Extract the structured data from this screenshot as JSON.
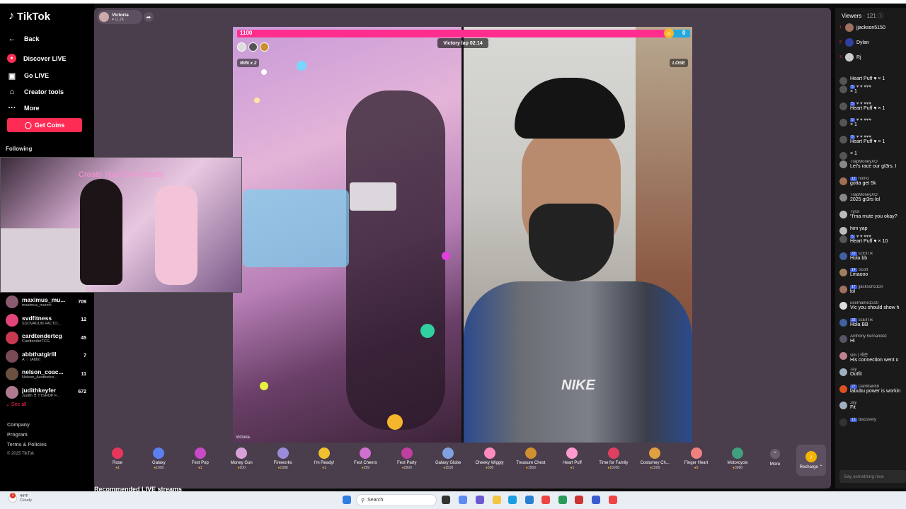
{
  "app": {
    "logo": "TikTok"
  },
  "sidebar": {
    "back": "Back",
    "nav": [
      {
        "label": "Discover LIVE",
        "icon": "live-icon"
      },
      {
        "label": "Go LIVE",
        "icon": "camera-icon"
      },
      {
        "label": "Creator tools",
        "icon": "home-icon"
      },
      {
        "label": "More",
        "icon": "more-icon"
      }
    ],
    "get_coins": "Get Coins",
    "following_title": "Following",
    "following": [
      {
        "name": "maximus_mu...",
        "sub": "maximus_munch",
        "count": "709",
        "color": "#8a5a70"
      },
      {
        "name": "svdfitness",
        "sub": "SUOVADUN FACTO...",
        "count": "12",
        "color": "#e0457b"
      },
      {
        "name": "cardtendertcg",
        "sub": "CardtenderTCG",
        "count": "45",
        "color": "#c8394f"
      },
      {
        "name": "abbthatgirlll",
        "sub": "A ♡ (Abbi)",
        "count": "7",
        "color": "#7a4a55"
      },
      {
        "name": "nelson_coac...",
        "sub": "Nelson_Aesthetics...",
        "count": "11",
        "color": "#6a5040"
      },
      {
        "name": "judithkeyfer",
        "sub": "Judith ❣ TTSHOP F...",
        "count": "672",
        "color": "#b07a90"
      }
    ],
    "see_all": "See all",
    "footer": [
      "Company",
      "Program",
      "Terms & Policies",
      "© 2025 TikTok"
    ]
  },
  "pip": {
    "neon_text": "Create Your Own Reality"
  },
  "host": {
    "name": "Victoria",
    "likes": "♥ 11.2K"
  },
  "battle": {
    "left_score": "1100",
    "right_score": "0",
    "left_share": 0.95,
    "timer": "Victory lap 02:14",
    "win_tag": "WIN x 2",
    "lose_tag": "LOSE",
    "left_name": "Victoria",
    "brand": "NIKE",
    "colors": {
      "left": "#ff2e8e",
      "right": "#22a9e0"
    }
  },
  "gifts": [
    {
      "name": "Rose",
      "price": "1",
      "color": "#e8365a"
    },
    {
      "name": "Galaxy",
      "price": "1000",
      "color": "#5a7ff0"
    },
    {
      "name": "Fest Pop",
      "price": "1",
      "color": "#c84ac8"
    },
    {
      "name": "Money Gun",
      "price": "500",
      "color": "#d8a0d8"
    },
    {
      "name": "Fireworks",
      "price": "1088",
      "color": "#9a8cd8"
    },
    {
      "name": "I'm Ready!",
      "price": "1",
      "color": "#f0c030"
    },
    {
      "name": "Fest Cheers",
      "price": "299",
      "color": "#d070d0"
    },
    {
      "name": "Fest Party",
      "price": "2999",
      "color": "#c040a0"
    },
    {
      "name": "Galaxy Globe",
      "price": "1500",
      "color": "#80a0e0"
    },
    {
      "name": "Cheeky Wiggly",
      "price": "500",
      "color": "#ff8ac0"
    },
    {
      "name": "Treasure Chest",
      "price": "1500",
      "color": "#d09030"
    },
    {
      "name": "Heart Puff",
      "price": "1",
      "color": "#ff9ad0"
    },
    {
      "name": "Time for Family",
      "price": "15000",
      "color": "#e04060"
    },
    {
      "name": "Costumey Ch...",
      "price": "1500",
      "color": "#e0a040"
    },
    {
      "name": "Finger Heart",
      "price": "5",
      "color": "#f08080"
    },
    {
      "name": "Motorcycle",
      "price": "3988",
      "color": "#40a080"
    }
  ],
  "gift_more": "More",
  "recharge": "Recharge",
  "recommended": "Recommended LIVE streams",
  "chat": {
    "viewers_label": "Viewers",
    "viewers_count": "121",
    "top_viewers": [
      {
        "rank": "1",
        "name": "jjackson5150",
        "color": "#a07060"
      },
      {
        "rank": "2",
        "name": "Dylan",
        "color": "#3040a0"
      },
      {
        "rank": "3",
        "name": "Rj",
        "color": "#ccc"
      }
    ],
    "messages": [
      {
        "user": "",
        "text": "Heart Puff ♥ × 1",
        "color": "#555",
        "badge": ""
      },
      {
        "user": "♥ ♥ ♥♥♥",
        "text": "× 1",
        "color": "#555",
        "badge": "5"
      },
      {
        "user": "♥ ♥ ♥♥♥",
        "text": "Heart Puff ♥ × 1",
        "color": "#555",
        "badge": "5"
      },
      {
        "user": "♥ ♥ ♥♥♥",
        "text": "× 1",
        "color": "#555",
        "badge": "5"
      },
      {
        "user": "♥ ♥ ♥♥♥",
        "text": "Heart Puff ♥ × 1",
        "color": "#555",
        "badge": "5"
      },
      {
        "user": "",
        "text": "× 1",
        "color": "#555",
        "badge": ""
      },
      {
        "user": "TrapMoneyXO",
        "text": "Let's race our gt3rs. I",
        "color": "#888",
        "badge": ""
      },
      {
        "user": "nomo",
        "text": "gotta get 5k",
        "color": "#a07050",
        "badge": "12"
      },
      {
        "user": "TrapMoneyXO",
        "text": "2025 gt3rs lol",
        "color": "#888",
        "badge": ""
      },
      {
        "user": "Tyrol",
        "text": "“I'ma mute you okay?",
        "color": "#bbb",
        "badge": ""
      },
      {
        "user": "",
        "text": "him yap",
        "color": "#bbb",
        "badge": ""
      },
      {
        "user": "♥ ♥ ♥♥♥",
        "text": "Heart Puff ♥ × 10",
        "color": "#555",
        "badge": "5"
      },
      {
        "user": "scEllTix",
        "text": "Hola bb",
        "color": "#4060a0",
        "badge": "33"
      },
      {
        "user": "Scott",
        "text": "Lmaooo",
        "color": "#a08060",
        "badge": "14"
      },
      {
        "user": "jjackson5150",
        "text": "lol",
        "color": "#a07060",
        "badge": "17"
      },
      {
        "user": "username1310",
        "text": "Vic you should show h",
        "color": "#ddd",
        "badge": ""
      },
      {
        "user": "scEllTix",
        "text": "Hola BB",
        "color": "#4060a0",
        "badge": "33"
      },
      {
        "user": "Anthony hernandez",
        "text": "Hi",
        "color": "#556",
        "badge": ""
      },
      {
        "user": "sim | 태준",
        "text": "His connection went o",
        "color": "#c08090",
        "badge": ""
      },
      {
        "user": "Jay",
        "text": "Outfit",
        "color": "#a0b0c0",
        "badge": ""
      },
      {
        "user": "DanMan88",
        "text": "labubu power is workin",
        "color": "#e05020",
        "badge": "27"
      },
      {
        "user": "Jay",
        "text": "Fit",
        "color": "#a0b0c0",
        "badge": ""
      },
      {
        "user": "discovery",
        "text": "",
        "color": "#333",
        "badge": "13"
      }
    ],
    "input_placeholder": "Say something nice"
  },
  "taskbar": {
    "weather_temp": "44°F",
    "weather_desc": "Cloudy",
    "notification_count": "2",
    "search_placeholder": "Search"
  }
}
